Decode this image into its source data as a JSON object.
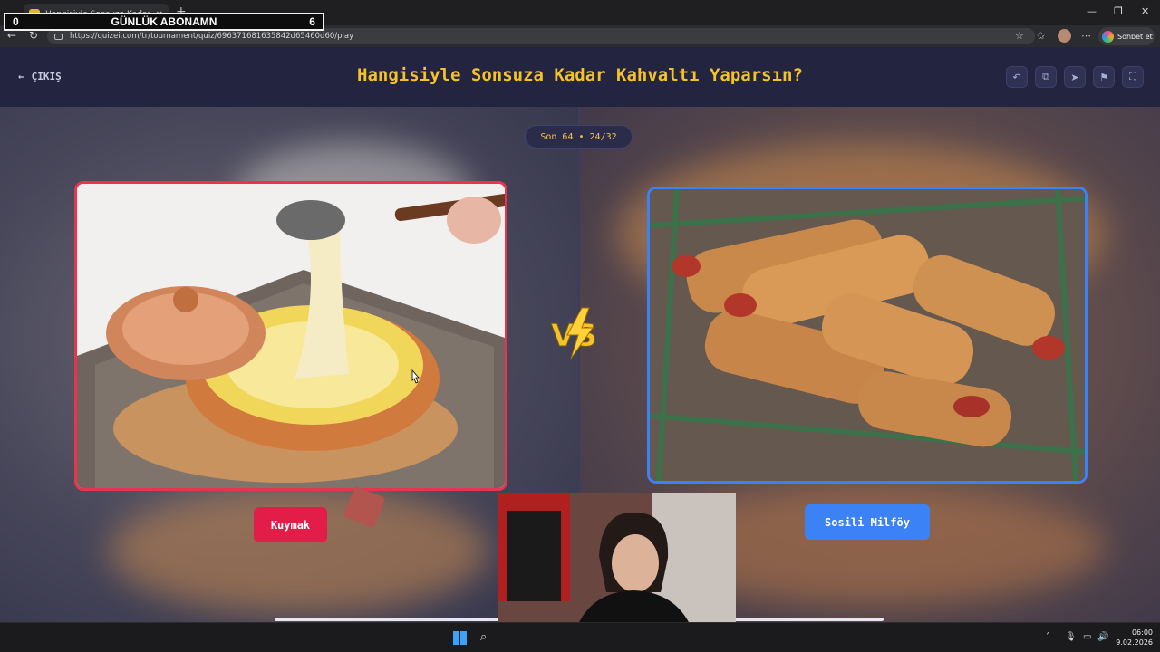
{
  "browser": {
    "tab_title": "Hangisiyle Sonsuza Kadar Kahvaltı",
    "url": "https://quizei.com/tr/tournament/quiz/696371681635842d65460d60/play",
    "copilot_label": "Sohbet et"
  },
  "overlay": {
    "left_count": "0",
    "label": "GÜNLÜK ABONAMN",
    "right_count": "6"
  },
  "header": {
    "exit_label": "ÇIKIŞ",
    "title": "Hangisiyle Sonsuza Kadar Kahvaltı Yaparsın?",
    "icons": [
      "undo-icon",
      "share-icon",
      "send-icon",
      "flag-icon",
      "fullscreen-icon"
    ]
  },
  "round": {
    "label": "Son 64 • 24/32"
  },
  "choices": [
    {
      "label": "Kuymak",
      "color": "#e11d48"
    },
    {
      "label": "Sosili Milföy",
      "color": "#3b82f6"
    }
  ],
  "colors": {
    "title": "#f5c22a",
    "left_border": "#e8344e",
    "right_border": "#3b82f6"
  },
  "taskbar": {
    "time": "06:00",
    "date": "9.02.2026"
  }
}
